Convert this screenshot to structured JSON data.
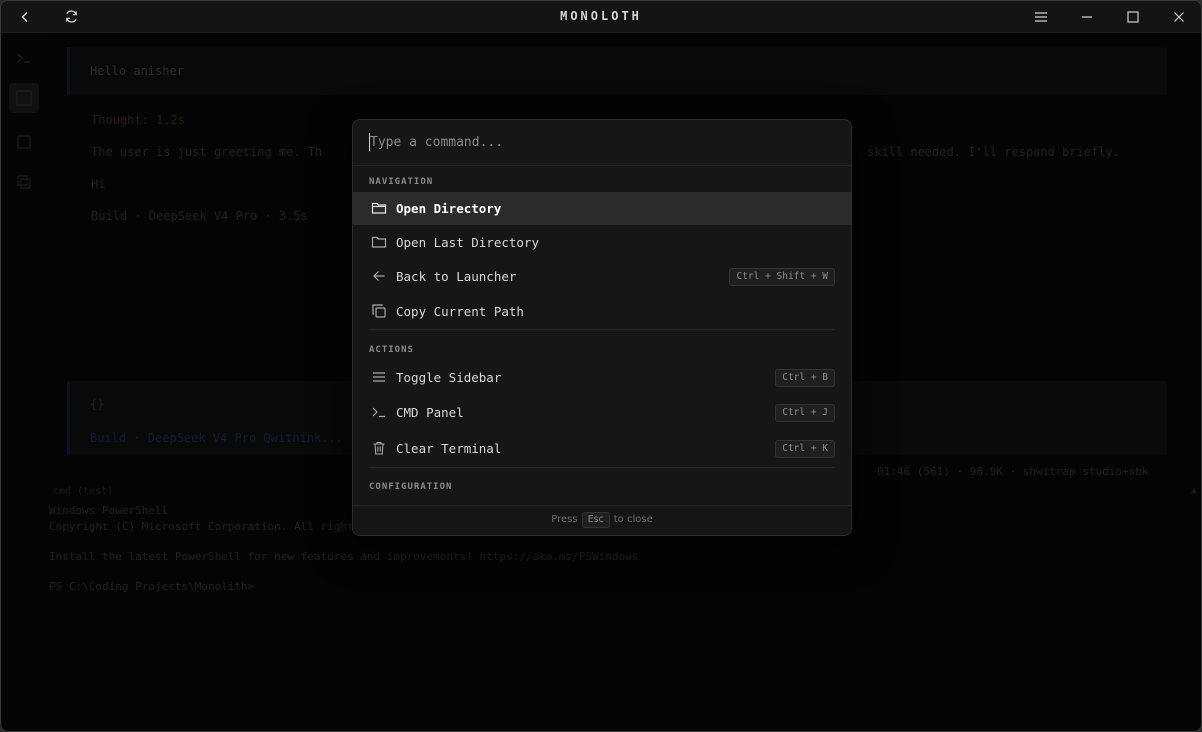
{
  "app": {
    "title": "MONOLOTH"
  },
  "background": {
    "chat_user_message": "Hello anisher",
    "thought_label": "Thought: 1.2s",
    "assistant_text": "The user is just greeting me. Th",
    "assistant_text_tail": "skill needed. I'll respond briefly.",
    "reply": "Hi",
    "model_tag": "Build · DeepSeek V4 Pro · 3.5s",
    "second_block_glyph": "{}",
    "second_block_meta": "Build · DeepSeek V4 Pro Qwithink...",
    "status_line": "01:46 (561) · 98.9K ·  shwitrap  studio+sbk",
    "terminal_tab": "  cmd (test)",
    "terminal_lines": [
      "Windows PowerShell",
      "Copyright (C) Microsoft Corporation. All rights reserved.",
      "Install the latest PowerShell for new features and improvements! https://aka.ms/PSWindows",
      "PS C:\\Coding Projects\\Monolith> "
    ]
  },
  "palette": {
    "search_placeholder": "Type a command...",
    "sections": [
      {
        "label": "NAVIGATION",
        "items": [
          {
            "label": "Open Directory",
            "icon": "folder-icon",
            "shortcut": ""
          },
          {
            "label": "Open Last Directory",
            "icon": "folder-icon",
            "shortcut": ""
          },
          {
            "label": "Back to Launcher",
            "icon": "arrow-left-icon",
            "shortcut": "Ctrl + Shift + W"
          },
          {
            "label": "Copy Current Path",
            "icon": "copy-icon",
            "shortcut": ""
          }
        ]
      },
      {
        "label": "ACTIONS",
        "items": [
          {
            "label": "Toggle Sidebar",
            "icon": "menu-icon",
            "shortcut": "Ctrl + B"
          },
          {
            "label": "CMD Panel",
            "icon": "terminal-icon",
            "shortcut": "Ctrl + J"
          },
          {
            "label": "Clear Terminal",
            "icon": "trash-icon",
            "shortcut": "Ctrl + K"
          }
        ]
      },
      {
        "label": "CONFIGURATION",
        "items": []
      }
    ],
    "footer": {
      "press": "Press",
      "key": "Esc",
      "action": "to close"
    }
  }
}
